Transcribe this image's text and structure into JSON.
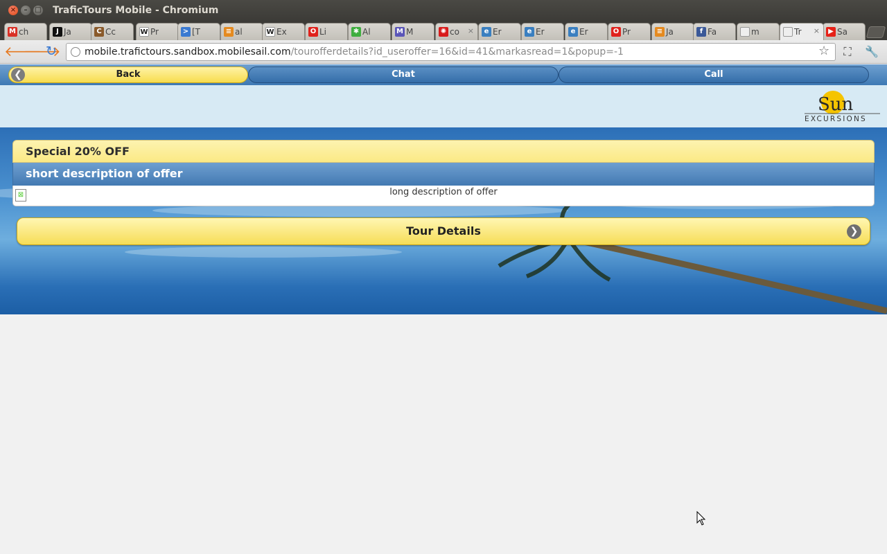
{
  "window": {
    "title": "TraficTours Mobile - Chromium",
    "close_glyph": "×",
    "min_glyph": "–",
    "max_glyph": "□"
  },
  "tabs": [
    {
      "label": "ch",
      "favicon": "gmail-icon",
      "color": "#d93025",
      "glyph": "M"
    },
    {
      "label": "Ja",
      "favicon": "page-icon",
      "color": "#111111",
      "glyph": "J"
    },
    {
      "label": "Cc",
      "favicon": "avatar-icon",
      "color": "#8a5a2b",
      "glyph": "C"
    },
    {
      "label": "Pr",
      "favicon": "wikipedia-icon",
      "color": "#ffffff",
      "glyph": "W"
    },
    {
      "label": "[T",
      "favicon": "arrow-icon",
      "color": "#3b7ad1",
      "glyph": ">"
    },
    {
      "label": "al",
      "favicon": "stack-icon",
      "color": "#e58a1f",
      "glyph": "≡"
    },
    {
      "label": "Ex",
      "favicon": "wikipedia-icon",
      "color": "#ffffff",
      "glyph": "W"
    },
    {
      "label": "Li",
      "favicon": "oracle-icon",
      "color": "#e0221c",
      "glyph": "O"
    },
    {
      "label": "Al",
      "favicon": "green-star-icon",
      "color": "#3fae3f",
      "glyph": "✱"
    },
    {
      "label": "M",
      "favicon": "mascot-icon",
      "color": "#5b56b8",
      "glyph": "M"
    },
    {
      "label": "co",
      "favicon": "red-gear-icon",
      "color": "#d81b1b",
      "glyph": "✺"
    },
    {
      "label": "Er",
      "favicon": "eclipse-icon",
      "color": "#3a7fc0",
      "glyph": "e"
    },
    {
      "label": "Er",
      "favicon": "eclipse-icon",
      "color": "#3a7fc0",
      "glyph": "e"
    },
    {
      "label": "Er",
      "favicon": "eclipse-icon",
      "color": "#3a7fc0",
      "glyph": "e"
    },
    {
      "label": "Pr",
      "favicon": "oracle-icon",
      "color": "#e0221c",
      "glyph": "O"
    },
    {
      "label": "Ja",
      "favicon": "stack-icon",
      "color": "#e58a1f",
      "glyph": "≡"
    },
    {
      "label": "Fa",
      "favicon": "facebook-icon",
      "color": "#3b5998",
      "glyph": "f"
    },
    {
      "label": "m",
      "favicon": "document-icon",
      "color": "#eeeeee",
      "glyph": ""
    },
    {
      "label": "Tr",
      "favicon": "document-icon",
      "color": "#eeeeee",
      "glyph": "",
      "active": true
    },
    {
      "label": "Sa",
      "favicon": "youtube-icon",
      "color": "#e62117",
      "glyph": "▶"
    }
  ],
  "tab_close_glyph": "×",
  "toolbar": {
    "back_glyph": "🡐",
    "forward_glyph": "🡒",
    "reload_glyph": "↻",
    "url_host": "mobile.trafictours.sandbox.mobilesail.com",
    "url_path": "/tourofferdetails?id_useroffer=16&id=41&markasread=1&popup=-1",
    "star_glyph": "☆",
    "fullscreen_glyph": "⛶",
    "wrench_glyph": "🔧"
  },
  "page": {
    "header": {
      "back_label": "Back",
      "chat_label": "Chat",
      "call_label": "Call",
      "back_arrow_glyph": "❮"
    },
    "logo": {
      "name": "Sun",
      "subtitle": "EXCURSIONS",
      "accent": "#f5c400"
    },
    "offer": {
      "title": "Special 20% OFF",
      "short_description": "short description of offer",
      "long_description": "long description of offer"
    },
    "tour_details": {
      "label": "Tour Details",
      "arrow_glyph": "❯"
    }
  },
  "colors": {
    "yellow_button": "#f7dd4e",
    "blue_button": "#3e79b4",
    "logo_band": "#d7eaf4"
  }
}
